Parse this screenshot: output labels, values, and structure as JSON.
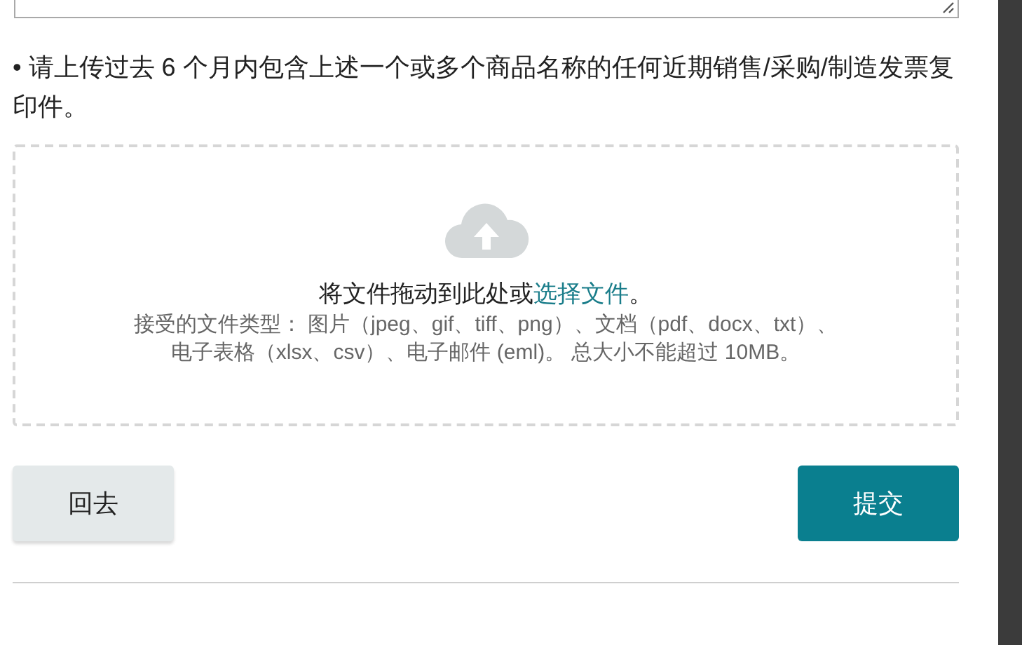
{
  "text_area": {
    "resizable": true
  },
  "instruction": "• 请上传过去 6 个月内包含上述一个或多个商品名称的任何近期销售/采购/制造发票复印件。",
  "dropzone": {
    "prompt": "将文件拖动到此处或",
    "link": "选择文件",
    "prompt_end": "。",
    "accepted_lines": [
      "接受的文件类型： 图片（jpeg、gif、tiff、png）、文档（pdf、docx、txt）、",
      "电子表格（xlsx、csv）、电子邮件 (eml)。 总大小不能超过 10MB。"
    ]
  },
  "buttons": [
    {
      "label": "回去",
      "kind": "secondary"
    },
    {
      "label": "提交",
      "kind": "primary"
    }
  ]
}
